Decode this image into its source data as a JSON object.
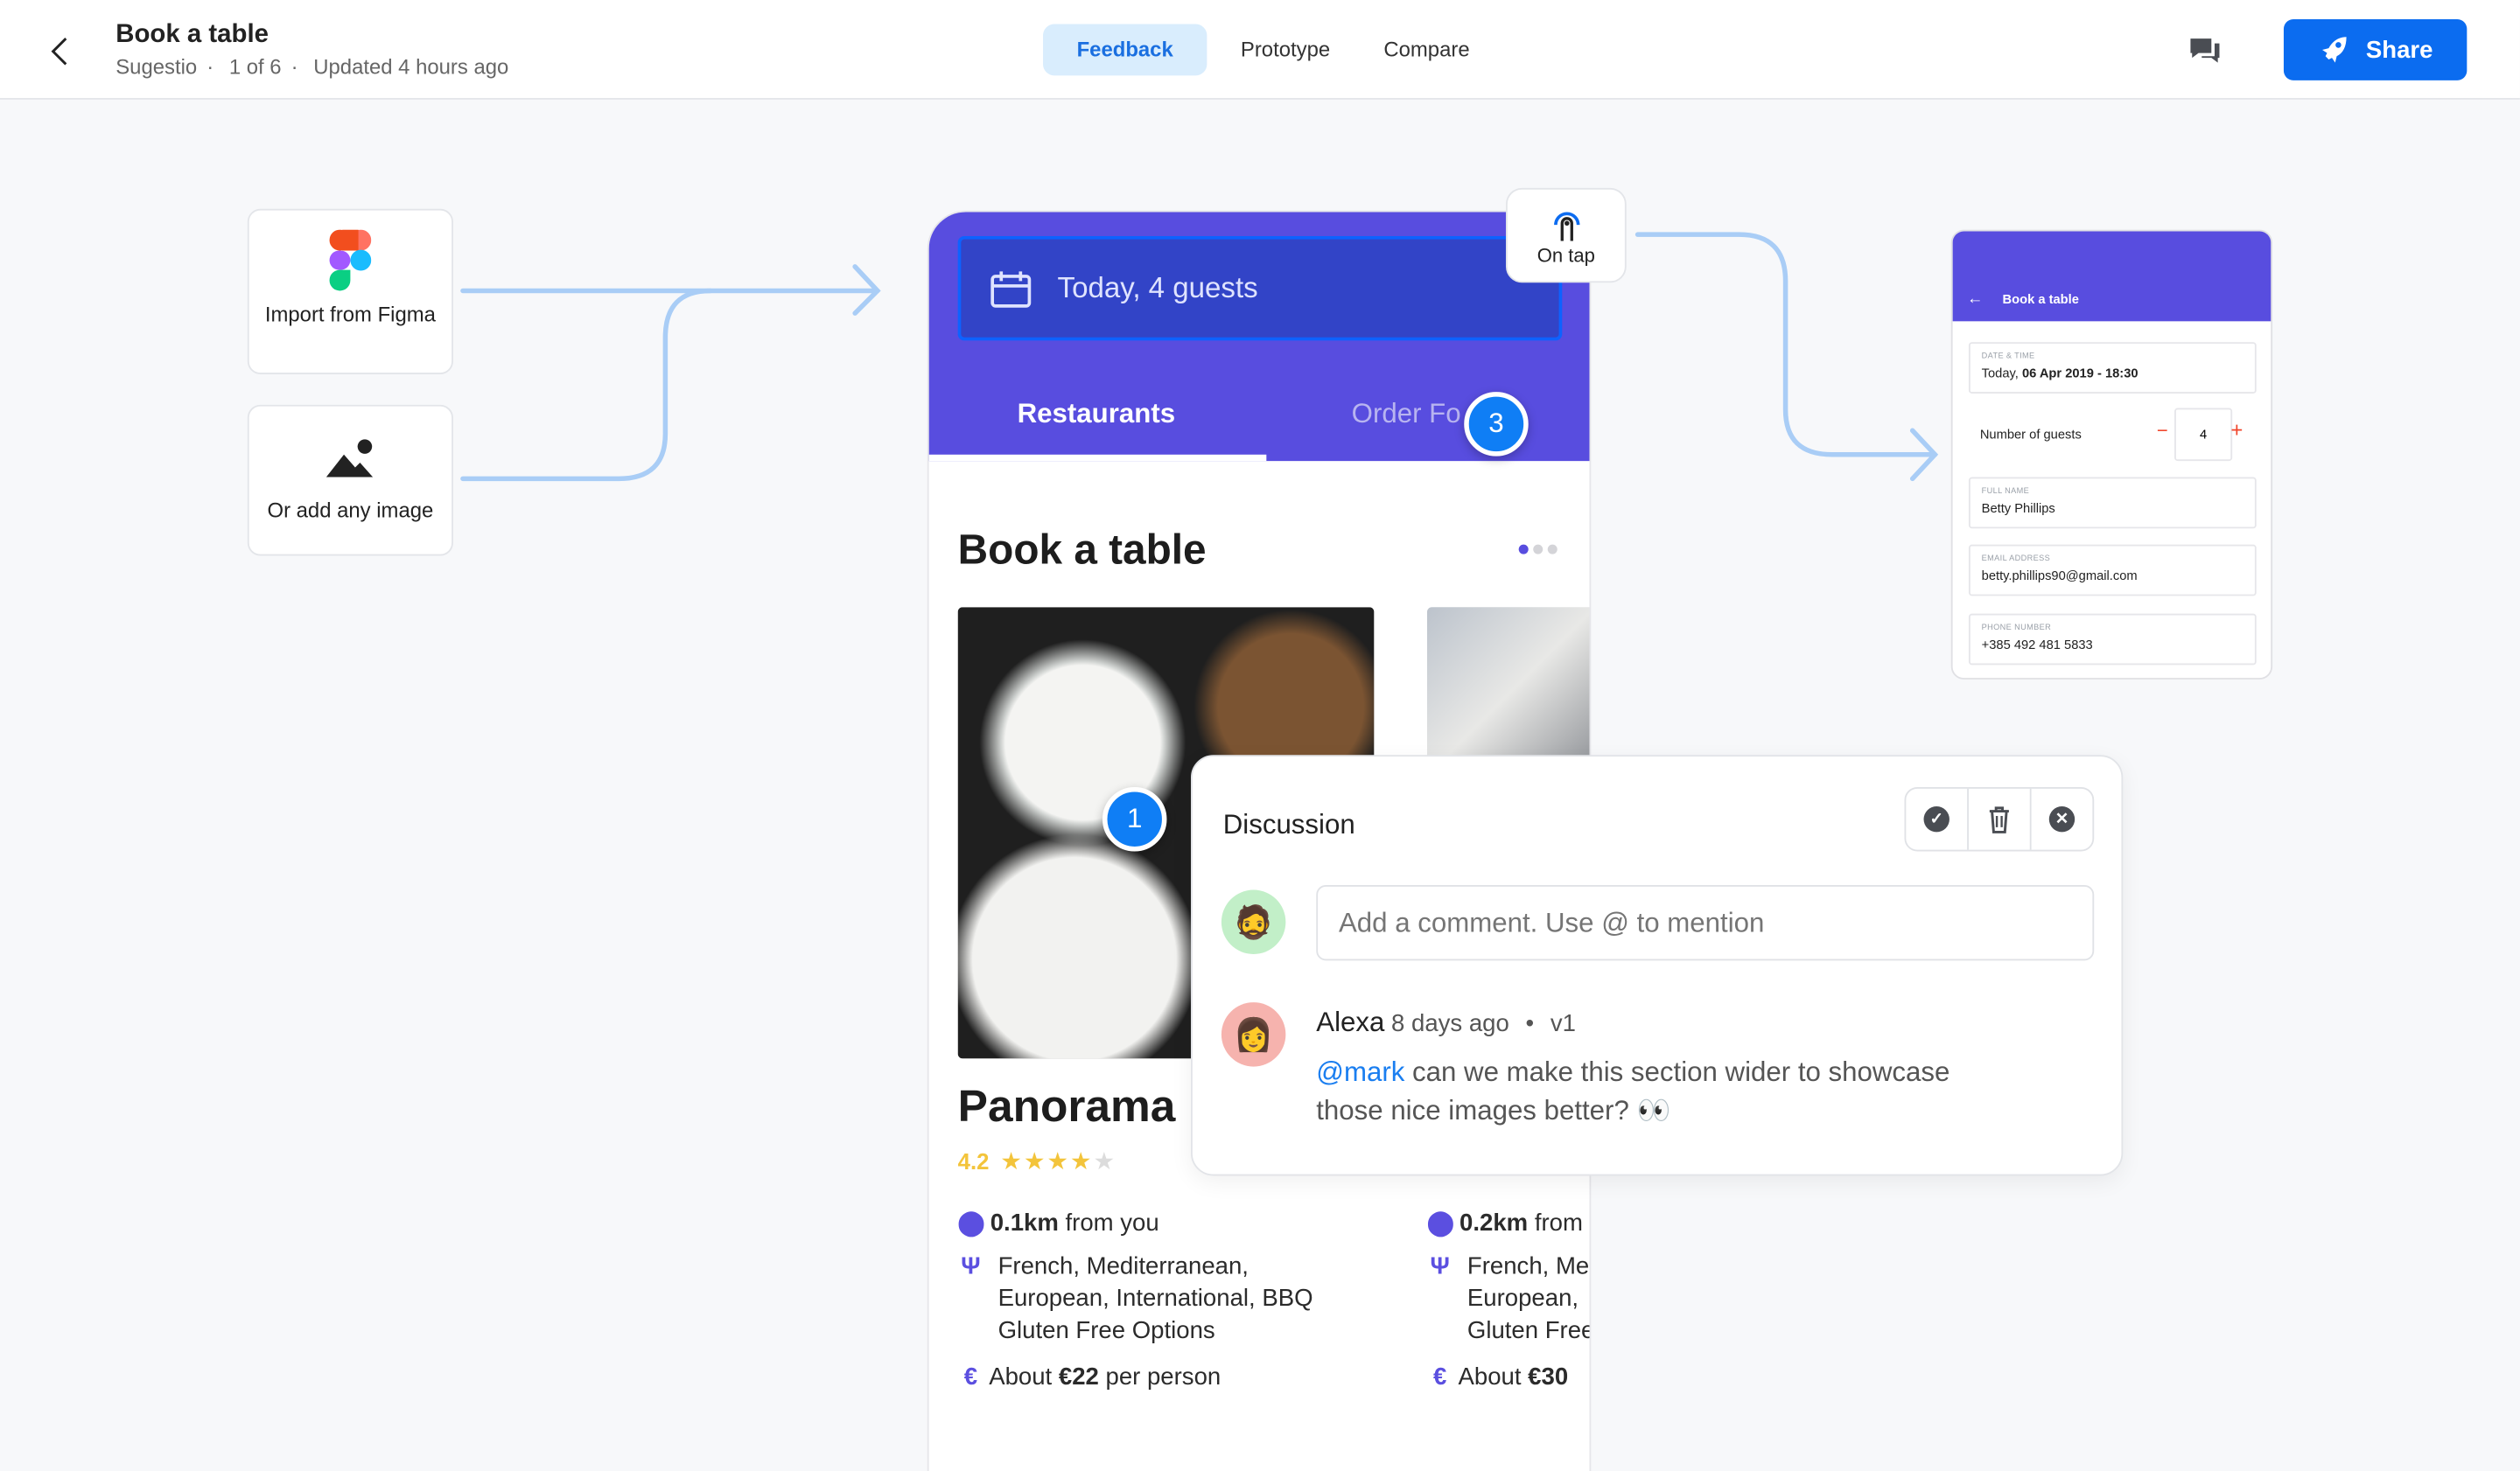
{
  "header": {
    "title": "Book a table",
    "project": "Sugestio",
    "position": "1 of 6",
    "updated": "Updated 4 hours ago",
    "separator": "·",
    "tabs": [
      {
        "label": "Feedback",
        "active": true
      },
      {
        "label": "Prototype",
        "active": false
      },
      {
        "label": "Compare",
        "active": false
      }
    ],
    "share_label": "Share",
    "accent": "#0b6cf0"
  },
  "sources": {
    "figma_label": "Import from Figma",
    "image_label": "Or add any image"
  },
  "phone": {
    "date_label": "Today, 4 guests",
    "tabs": [
      "Restaurants",
      "Order Fo"
    ],
    "heading": "Book a table",
    "restaurant_name": "Panorama",
    "rating": "4.2",
    "rating_value": 4.2,
    "stars_max": 5,
    "col1": {
      "distance_bold": "0.1km",
      "distance_rest": " from you",
      "cuisine": [
        "French, Mediterranean,",
        "European, International, BBQ",
        "Gluten Free Options"
      ],
      "price_pre": "About ",
      "price_bold": "€22",
      "price_post": " per person"
    },
    "col2": {
      "distance_bold": "0.2km",
      "distance_rest": " from",
      "cuisine": [
        "French, Me",
        "European,",
        "Gluten Free"
      ],
      "price_pre": "About ",
      "price_bold": "€30"
    },
    "brand_color": "#584ddf"
  },
  "hotspots": {
    "on_tap_label": "On tap",
    "badge_3": "3",
    "badge_1": "1"
  },
  "discussion": {
    "title": "Discussion",
    "input_placeholder": "Add a comment. Use @ to mention",
    "comment": {
      "author": "Alexa",
      "time": "8 days ago",
      "bullet": "•",
      "version": "v1",
      "mention": "@mark",
      "text_line1": " can we make this section wider to showcase",
      "text_line2": "those nice images better? 👀"
    }
  },
  "target_screen": {
    "title": "Book a table",
    "fields": [
      {
        "label": "DATE & TIME",
        "value_pre": "Today, ",
        "value_bold": "06 Apr 2019 - 18:30"
      },
      {
        "label": "FULL NAME",
        "value": "Betty Phillips"
      },
      {
        "label": "EMAIL ADDRESS",
        "value": "betty.phillips90@gmail.com"
      },
      {
        "label": "PHONE NUMBER",
        "value": "+385 492 481 5833"
      }
    ],
    "guests_label": "Number of guests",
    "guests_value": "4",
    "minus": "−",
    "plus": "+"
  }
}
